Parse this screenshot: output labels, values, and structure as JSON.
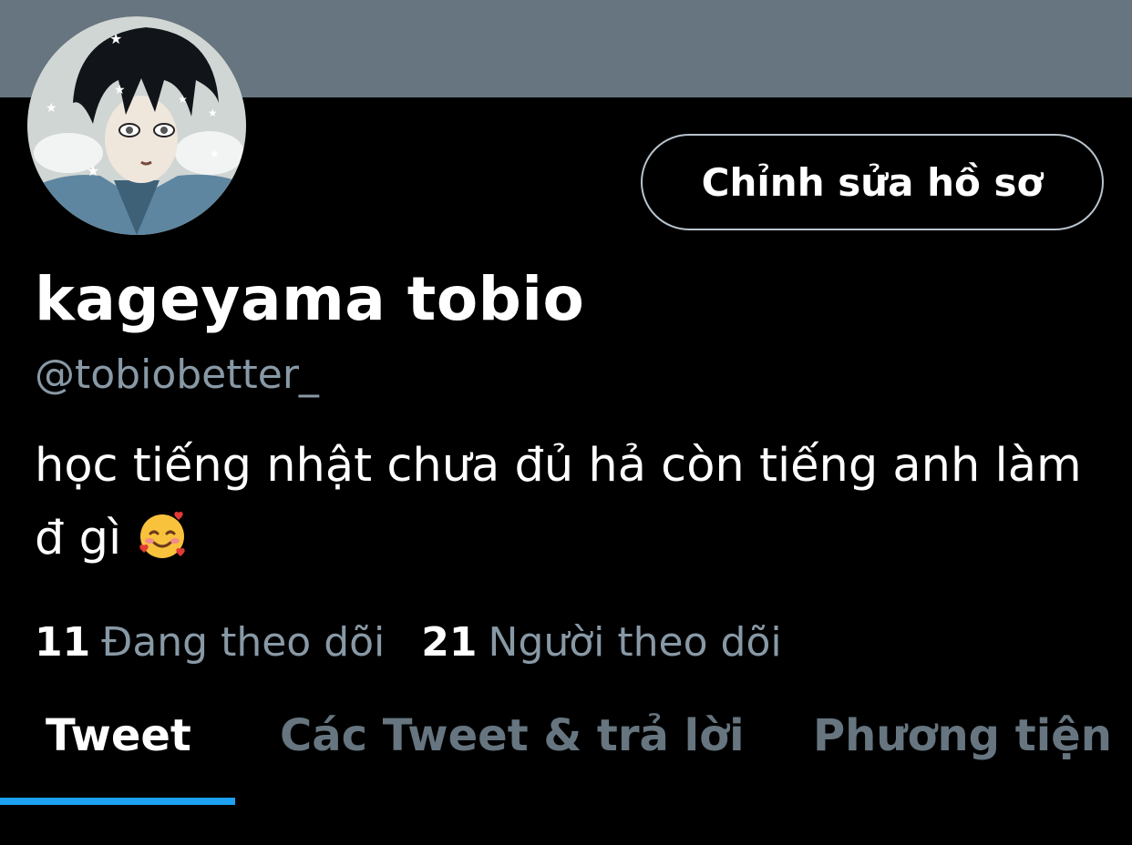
{
  "profile": {
    "banner_color": "#66757f",
    "avatar_icon": "profile-avatar-image",
    "edit_button_label": "Chỉnh sửa hồ sơ",
    "display_name": "kageyama tobio",
    "handle": "@tobiobetter_",
    "bio": "học tiếng nhật chưa đủ hả còn tiếng anh làm đ gì",
    "bio_emoji": "smiling-face-with-hearts-icon"
  },
  "stats": {
    "following_count": "11",
    "following_label": "Đang theo dõi",
    "followers_count": "21",
    "followers_label": "Người theo dõi"
  },
  "tabs": [
    {
      "label": "Tweet",
      "active": true
    },
    {
      "label": "Các Tweet & trả lời",
      "active": false
    },
    {
      "label": "Phương tiện",
      "active": false
    }
  ],
  "colors": {
    "accent": "#1da1f2",
    "secondary_text": "#8899a6",
    "inactive_tab": "#66757f",
    "background": "#000000"
  }
}
